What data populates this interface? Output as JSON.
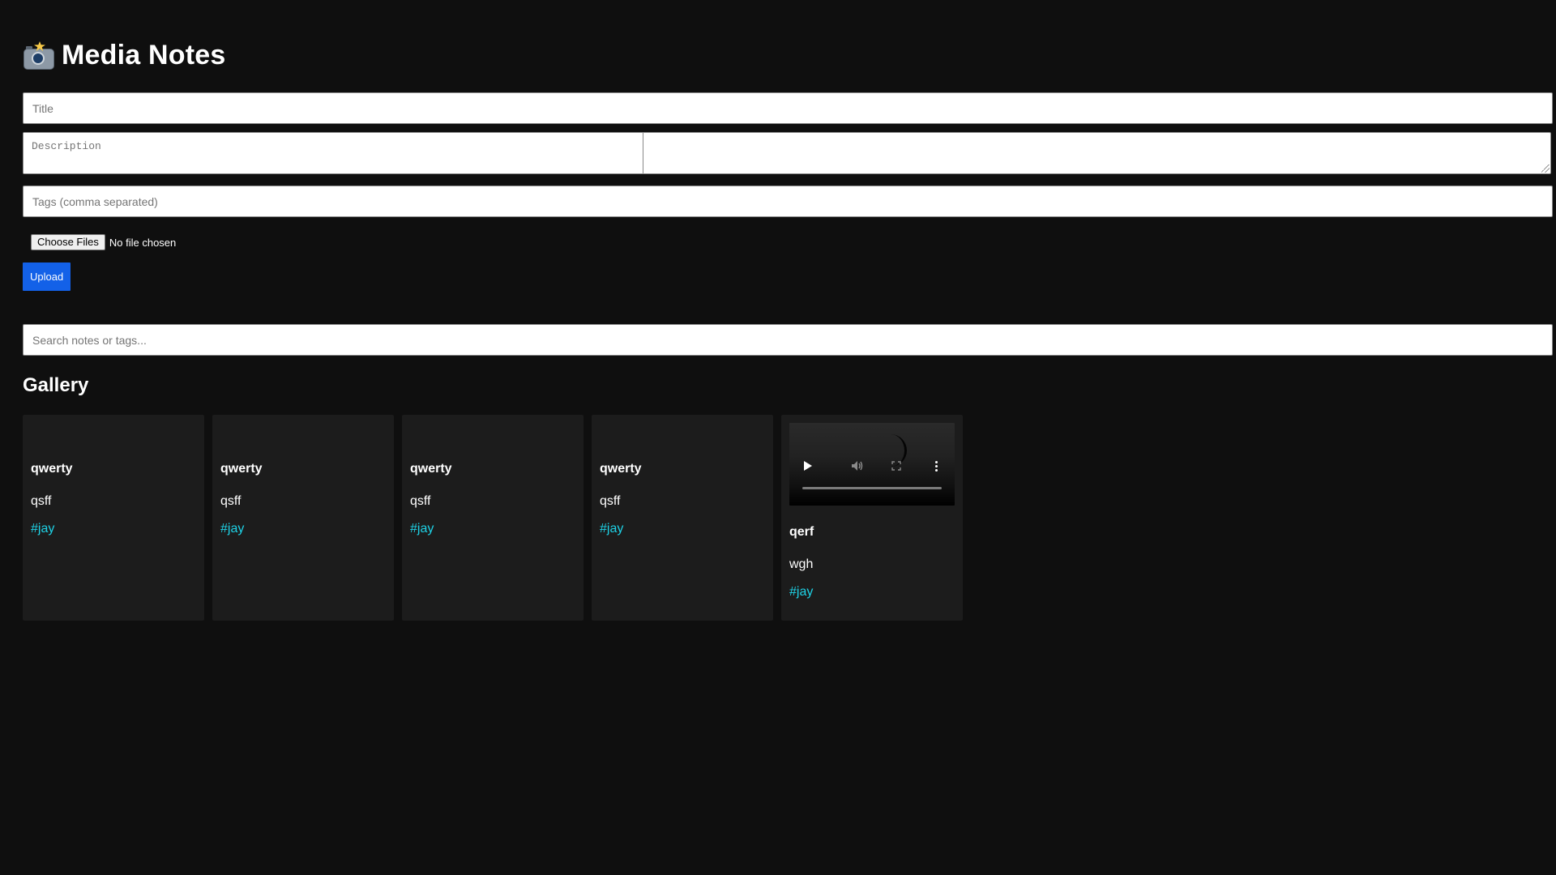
{
  "app": {
    "title": "Media Notes",
    "icon": "camera-flash-icon"
  },
  "form": {
    "title_placeholder": "Title",
    "description_placeholder": "Description",
    "tags_placeholder": "Tags (comma separated)",
    "file_button_label": "Choose Files",
    "file_status": "No file chosen",
    "upload_label": "Upload"
  },
  "search": {
    "placeholder": "Search notes or tags..."
  },
  "gallery": {
    "heading": "Gallery",
    "items": [
      {
        "title": "qwerty",
        "description": "qsff",
        "tag": "#jay",
        "media": "none"
      },
      {
        "title": "qwerty",
        "description": "qsff",
        "tag": "#jay",
        "media": "none"
      },
      {
        "title": "qwerty",
        "description": "qsff",
        "tag": "#jay",
        "media": "none"
      },
      {
        "title": "qwerty",
        "description": "qsff",
        "tag": "#jay",
        "media": "none"
      },
      {
        "title": "qerf",
        "description": "wgh",
        "tag": "#jay",
        "media": "video"
      }
    ]
  },
  "colors": {
    "background": "#0f0f0f",
    "card": "#1c1c1c",
    "accent": "#1361e8",
    "tag": "#1ed2e6"
  }
}
